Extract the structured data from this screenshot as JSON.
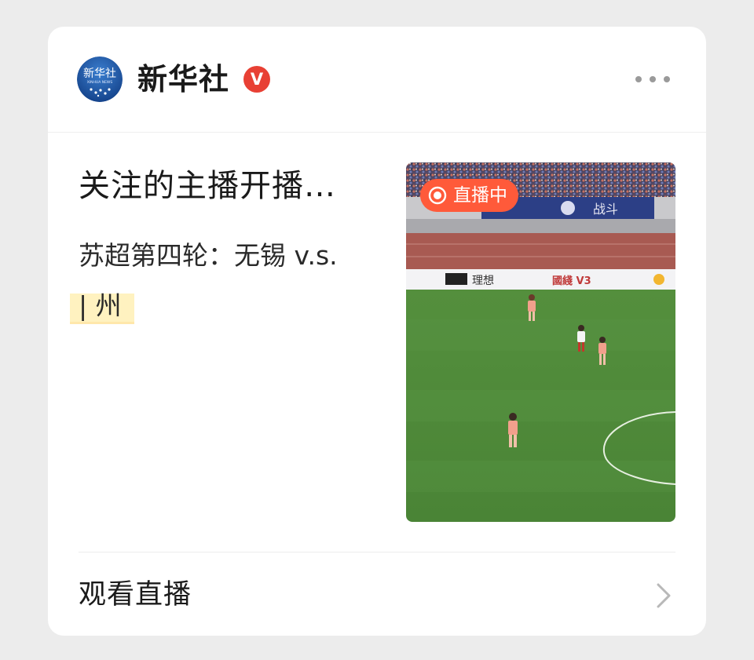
{
  "account": {
    "name": "新华社",
    "verified_mark": "V",
    "avatar_text": "新华社",
    "avatar_subtext": "XINHUA NEWS"
  },
  "post": {
    "title": "关注的主播开播…",
    "match_prefix": "苏超第四轮：",
    "match_highlight": "无锡 v.s.",
    "match_line2": "| 州"
  },
  "thumbnail": {
    "live_badge": "直播中",
    "banner_text": "战斗",
    "ad_brand_1": "理想",
    "ad_brand_2": "國綫 V3"
  },
  "footer": {
    "watch_label": "观看直播"
  },
  "colors": {
    "verified_red": "#e84034",
    "live_badge": "#ff5a3a",
    "pitch_green": "#4e8a3a",
    "highlight_yellow": "#ffe78c"
  },
  "icons": {
    "more": "more-dots-icon",
    "chevron": "chevron-right-icon",
    "live": "live-record-icon"
  }
}
